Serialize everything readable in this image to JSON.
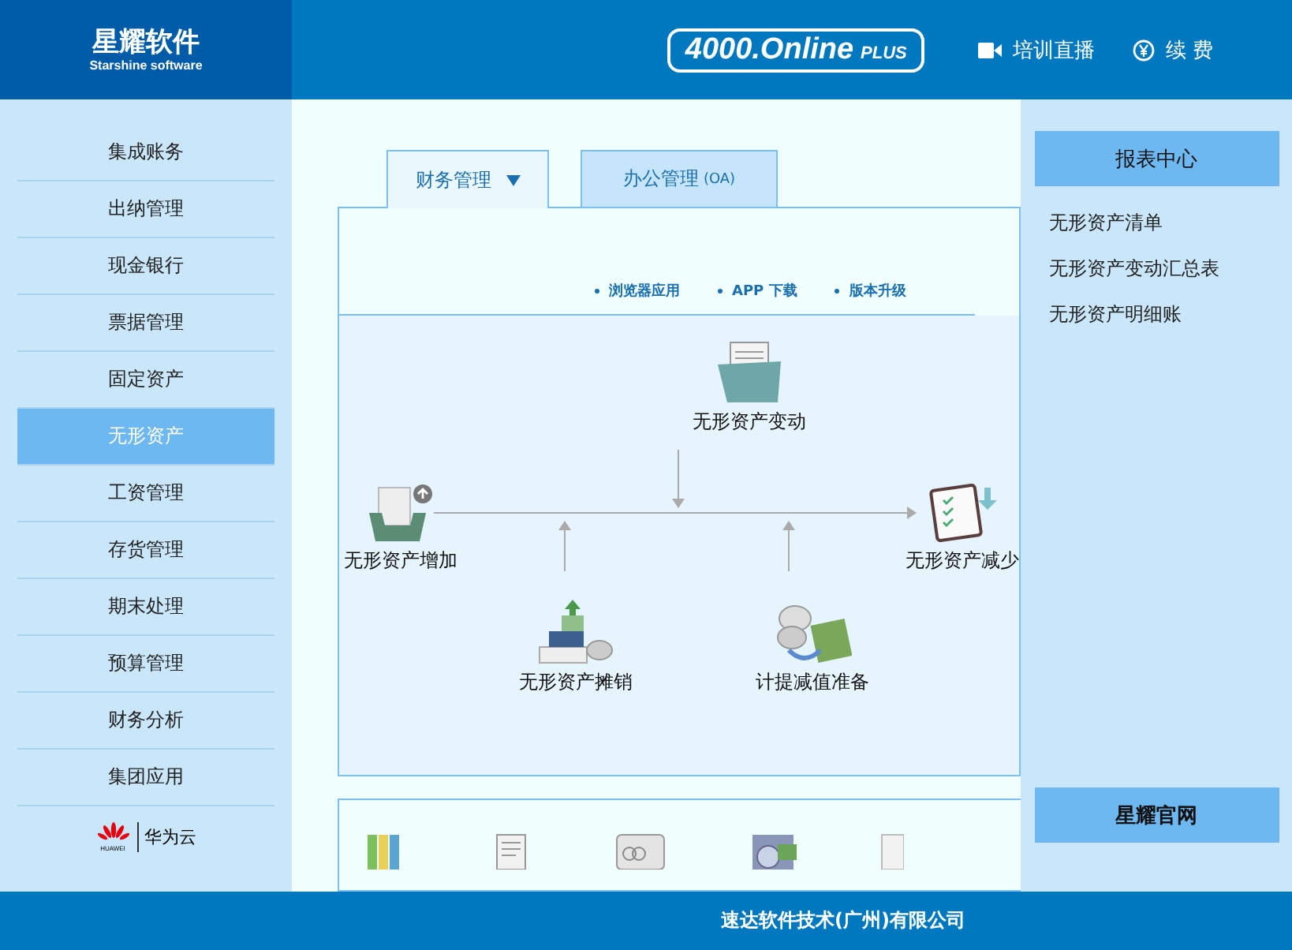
{
  "header": {
    "logo_title": "星耀软件",
    "logo_subtitle": "Starshine software",
    "product_badge": {
      "main": "4000.Online",
      "suffix": "PLUS"
    },
    "actions": [
      {
        "kind": "video",
        "label": "培训直播"
      },
      {
        "kind": "yen",
        "label": "续 费"
      }
    ]
  },
  "sidebar": {
    "items": [
      {
        "label": "集成账务",
        "selected": false
      },
      {
        "label": "出纳管理",
        "selected": false
      },
      {
        "label": "现金银行",
        "selected": false
      },
      {
        "label": "票据管理",
        "selected": false
      },
      {
        "label": "固定资产",
        "selected": false
      },
      {
        "label": "无形资产",
        "selected": true
      },
      {
        "label": "工资管理",
        "selected": false
      },
      {
        "label": "存货管理",
        "selected": false
      },
      {
        "label": "期末处理",
        "selected": false
      },
      {
        "label": "预算管理",
        "selected": false
      },
      {
        "label": "财务分析",
        "selected": false
      },
      {
        "label": "集团应用",
        "selected": false
      }
    ],
    "partner": {
      "brand": "HUAWEI",
      "label": "华为云"
    }
  },
  "tabs": [
    {
      "label": "财务管理",
      "selected": true,
      "dropdown": true
    },
    {
      "label": "办公管理",
      "suffix": "(OA)",
      "selected": false,
      "dropdown": false
    }
  ],
  "quick_links": [
    "浏览器应用",
    "APP 下载",
    "版本升级"
  ],
  "flow": {
    "nodes": [
      {
        "kind": "folder",
        "label": "无形资产变动"
      },
      {
        "kind": "inbox",
        "label": "无形资产增加"
      },
      {
        "kind": "checklist",
        "label": "无形资产减少"
      },
      {
        "kind": "stairs",
        "label": "无形资产摊销"
      },
      {
        "kind": "money",
        "label": "计提减值准备"
      }
    ]
  },
  "bottom_icons": [
    {
      "kind": "binders"
    },
    {
      "kind": "document"
    },
    {
      "kind": "card"
    },
    {
      "kind": "money"
    },
    {
      "kind": "paper"
    }
  ],
  "right_panel": {
    "title": "报表中心",
    "reports": [
      "无形资产清单",
      "无形资产变动汇总表",
      "无形资产明细账"
    ],
    "website_button": "星耀官网"
  },
  "footer": {
    "company": "速达软件技术(广州)有限公司"
  }
}
